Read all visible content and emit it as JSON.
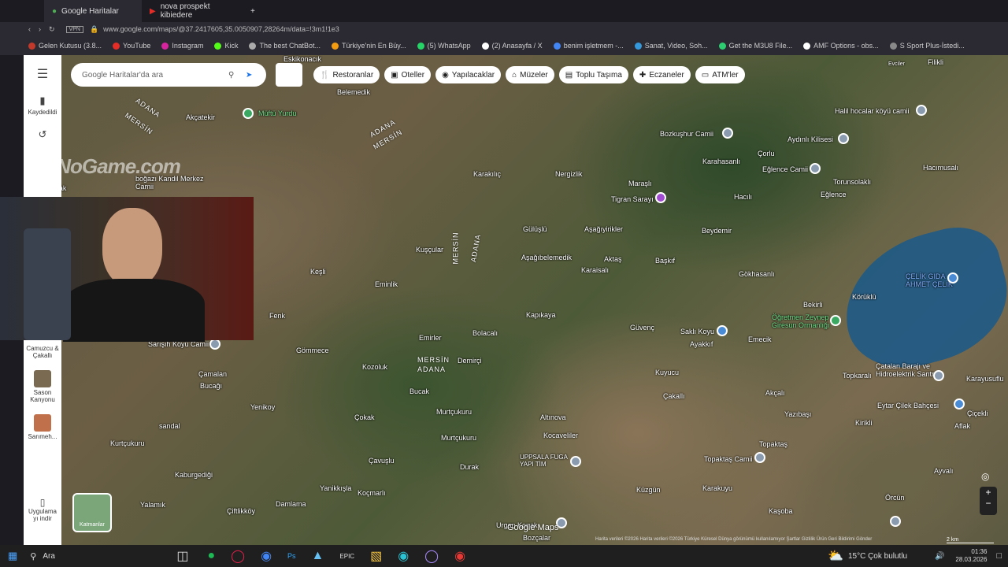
{
  "browser": {
    "active_tab": "Google Haritalar",
    "second_tab": "nova prospekt kibiedere",
    "new_tab": "+",
    "vpn": "VPN",
    "url": "www.google.com/maps/@37.2417605,35.0050907,28264m/data=!3m1!1e3"
  },
  "bookmarks": [
    {
      "label": "Gelen Kutusu (3.8...",
      "color": "#c0392b"
    },
    {
      "label": "YouTube",
      "color": "#e52d27"
    },
    {
      "label": "Instagram",
      "color": "#d6249f"
    },
    {
      "label": "Kick",
      "color": "#53fc18"
    },
    {
      "label": "The best ChatBot...",
      "color": "#aaa"
    },
    {
      "label": "Türkiye'nin En Büy...",
      "color": "#f39c12"
    },
    {
      "label": "(5) WhatsApp",
      "color": "#25d366"
    },
    {
      "label": "(2) Anasayfa / X",
      "color": "#fff"
    },
    {
      "label": "benim işletmem -...",
      "color": "#4285f4"
    },
    {
      "label": "Sanat, Video, Soh...",
      "color": "#3498db"
    },
    {
      "label": "Get the M3U8 File...",
      "color": "#2ecc71"
    },
    {
      "label": "AMF Options - obs...",
      "color": "#fff"
    },
    {
      "label": "S Sport Plus-İstedi...",
      "color": "#888"
    }
  ],
  "maps": {
    "search_placeholder": "Google Haritalar'da ara",
    "chips": [
      "Restoranlar",
      "Oteller",
      "Yapılacaklar",
      "Müzeler",
      "Toplu Taşıma",
      "Eczaneler",
      "ATM'ler"
    ],
    "saved_label": "Kaydedildi",
    "recent_items": [
      "Camuzcu & Çakallı",
      "Sason Kanyonu",
      "Sarımeh..."
    ],
    "get_app": "Uygulama yı indir",
    "layers_label": "Katmanlar",
    "brand": "Google Maps",
    "attribution": "Harita verileri ©2026  Harita verileri ©2026    Türkiye    Küresel Dünya görünümü kullanılamıyor    Şartlar    Gizlilik    Ürün Geri Bildirimi Gönder",
    "scale": "2 km",
    "watermark": "ByNoGame.com"
  },
  "places": [
    {
      "t": "Eskikonacık"
    },
    {
      "t": "Belemedik"
    },
    {
      "t": "Akçatekir"
    },
    {
      "t": "Müftü Yurdu"
    },
    {
      "t": "Karakılıç"
    },
    {
      "t": "Nergizlik"
    },
    {
      "t": "Maraşlı"
    },
    {
      "t": "Tigran Sarayı"
    },
    {
      "t": "Bozkuşhur Camii"
    },
    {
      "t": "Aydınlı Kilisesi"
    },
    {
      "t": "Halil hocalar köyü camii"
    },
    {
      "t": "Çorlu"
    },
    {
      "t": "Eğlence Camii"
    },
    {
      "t": "Karahasanlı"
    },
    {
      "t": "Torunsolaklı"
    },
    {
      "t": "Hacımusalı"
    },
    {
      "t": "Eğlence"
    },
    {
      "t": "Hacılı"
    },
    {
      "t": "Gülüşlü"
    },
    {
      "t": "Aşağıyirikler"
    },
    {
      "t": "Beydemir"
    },
    {
      "t": "Kuşçular"
    },
    {
      "t": "Aşağıbelemedik"
    },
    {
      "t": "Aktaş"
    },
    {
      "t": "Başkıf"
    },
    {
      "t": "Keşli"
    },
    {
      "t": "Karaisalı"
    },
    {
      "t": "Eminlik"
    },
    {
      "t": "Gökhasanlı"
    },
    {
      "t": "ÇELİK GIDA AHMET ÇELİK"
    },
    {
      "t": "Körüklü"
    },
    {
      "t": "Bekirli"
    },
    {
      "t": "Öğretmen Zeynep Giresun Ormanlığı"
    },
    {
      "t": "Fenk"
    },
    {
      "t": "Kapıkaya"
    },
    {
      "t": "Güvenç"
    },
    {
      "t": "Saklı Koyu"
    },
    {
      "t": "Ayakkıf"
    },
    {
      "t": "Emecik"
    },
    {
      "t": "Sarışıh Köyü Camii"
    },
    {
      "t": "Gömmece"
    },
    {
      "t": "Emirler"
    },
    {
      "t": "Bolacalı"
    },
    {
      "t": "Kozoluk"
    },
    {
      "t": "Demirçi"
    },
    {
      "t": "Çamalan"
    },
    {
      "t": "Bucağı"
    },
    {
      "t": "Kuyucu"
    },
    {
      "t": "Çatalan Barajı ve Hidroelektrik Santrali"
    },
    {
      "t": "Karayusuflu"
    },
    {
      "t": "Topkaralı"
    },
    {
      "t": "Akçalı"
    },
    {
      "t": "Eytar Çilek Bahçesi"
    },
    {
      "t": "Çiçekli"
    },
    {
      "t": "Yenikoy"
    },
    {
      "t": "Bucak"
    },
    {
      "t": "Çokak"
    },
    {
      "t": "Çakallı"
    },
    {
      "t": "Yazıbaşı"
    },
    {
      "t": "Kirikli"
    },
    {
      "t": "Aflak"
    },
    {
      "t": "Murtçukuru"
    },
    {
      "t": "Altınova"
    },
    {
      "t": "sandal"
    },
    {
      "t": "Kurtçukuru"
    },
    {
      "t": "Kocaveliler"
    },
    {
      "t": "Topaktaş"
    },
    {
      "t": "Topaktaş Camii"
    },
    {
      "t": "Murtçukuru"
    },
    {
      "t": "UPPSALA FUGA YAPI TİM"
    },
    {
      "t": "Kaburgediği"
    },
    {
      "t": "Çavuşlu"
    },
    {
      "t": "Durak"
    },
    {
      "t": "Yanikkışla"
    },
    {
      "t": "Koçmarlı"
    },
    {
      "t": "Küzgün"
    },
    {
      "t": "Karakuyu"
    },
    {
      "t": "Ayvalı"
    },
    {
      "t": "Yalamık"
    },
    {
      "t": "Damlama"
    },
    {
      "t": "Çiftlikköy"
    },
    {
      "t": "Kaşoba"
    },
    {
      "t": "Örcün"
    },
    {
      "t": "Bozçalar"
    },
    {
      "t": "Urgan Konak"
    },
    {
      "t": "Filikli"
    },
    {
      "t": "Evciler"
    },
    {
      "t": "Yayak"
    },
    {
      "t": "boğazı Kandil Merkez Camii"
    }
  ],
  "regions": [
    {
      "t": "ADANA"
    },
    {
      "t": "MERSİN"
    },
    {
      "t": "ADANA"
    },
    {
      "t": "MERSİN"
    },
    {
      "t": "MERSİN"
    },
    {
      "t": "ADANA"
    },
    {
      "t": "MERSİN"
    },
    {
      "t": "ADANA"
    }
  ],
  "roads": [
    "0-21",
    "D750",
    "0-21",
    "0-21",
    "D750",
    "0-21"
  ],
  "taskbar": {
    "search": "Ara",
    "weather": "15°C  Çok bulutlu",
    "time": "01:36",
    "date": "28.03.2026"
  }
}
